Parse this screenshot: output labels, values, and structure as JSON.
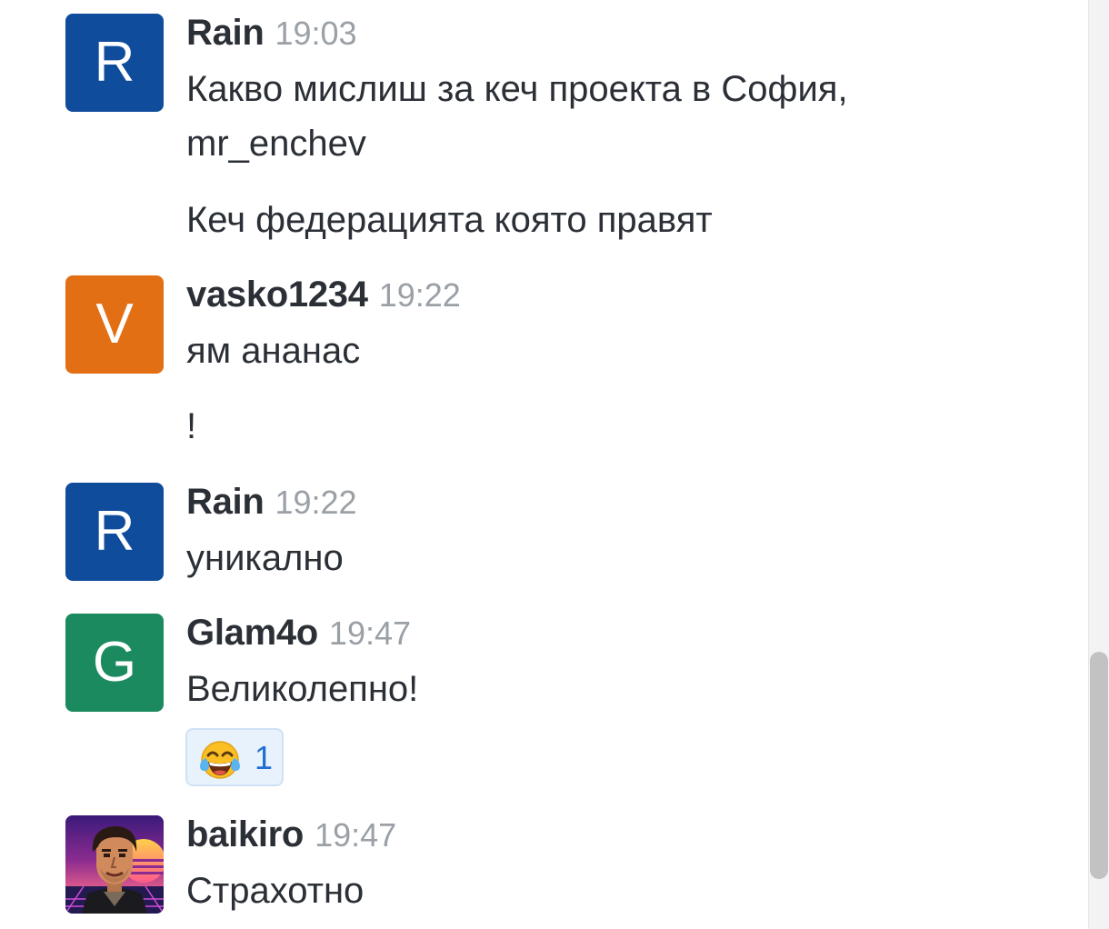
{
  "messages": [
    {
      "author": "Rain",
      "time": "19:03",
      "avatar": {
        "letter": "R",
        "color": "#0f4d9c"
      },
      "lines": [
        "Какво мислиш за кеч проекта в София,",
        "mr_enchev",
        "Кеч федерацията която правят"
      ]
    },
    {
      "author": "vasko1234",
      "time": "19:22",
      "avatar": {
        "letter": "V",
        "color": "#e36f14"
      },
      "lines": [
        "ям ананас",
        "!"
      ]
    },
    {
      "author": "Rain",
      "time": "19:22",
      "avatar": {
        "letter": "R",
        "color": "#0f4d9c"
      },
      "lines": [
        "уникално"
      ]
    },
    {
      "author": "Glam4o",
      "time": "19:47",
      "avatar": {
        "letter": "G",
        "color": "#1b8a5f"
      },
      "lines": [
        "Великолепно!"
      ],
      "reaction": {
        "emoji": "face-with-tears-of-joy-icon",
        "count": "1"
      }
    },
    {
      "author": "baikiro",
      "time": "19:47",
      "avatar": {
        "image": "pixel-art-portrait"
      },
      "lines": [
        "Страхотно"
      ]
    }
  ],
  "colors": {
    "author": "#2b2f36",
    "time": "#9aa0a6",
    "reaction_bg": "#e8f2fc",
    "reaction_border": "#cfe2f5",
    "reaction_count": "#1f6fd0"
  }
}
